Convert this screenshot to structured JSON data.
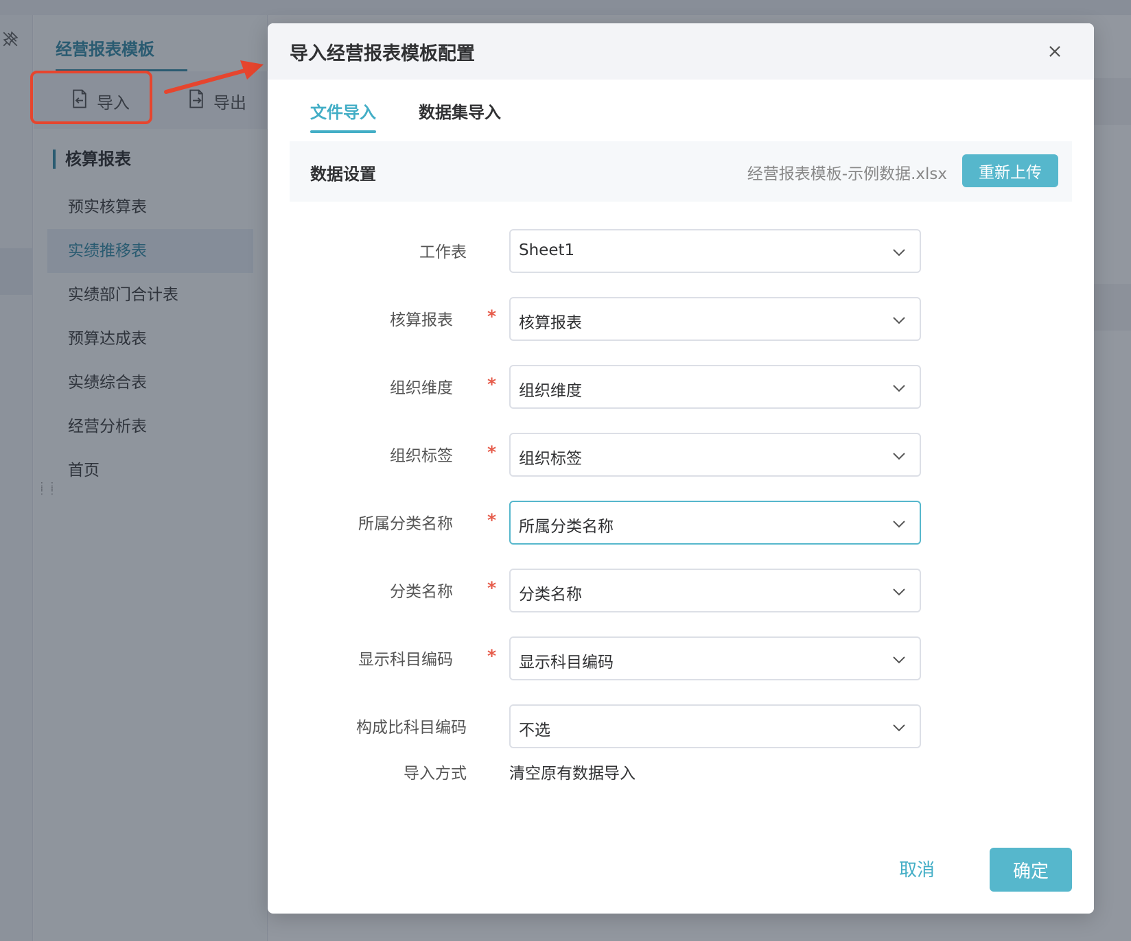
{
  "sidebar": {
    "title": "经营报表模板",
    "toolbar": {
      "import_label": "导入",
      "export_label": "导出"
    },
    "group_title": "核算报表",
    "items": [
      {
        "label": "预实核算表"
      },
      {
        "label": "实绩推移表",
        "active": true
      },
      {
        "label": "实绩部门合计表"
      },
      {
        "label": "预算达成表"
      },
      {
        "label": "实绩综合表"
      },
      {
        "label": "经营分析表"
      },
      {
        "label": "首页"
      }
    ]
  },
  "dialog": {
    "title": "导入经营报表模板配置",
    "tabs": [
      {
        "label": "文件导入",
        "active": true
      },
      {
        "label": "数据集导入",
        "active": false
      }
    ],
    "section": {
      "title": "数据设置",
      "file_name": "经营报表模板-示例数据.xlsx",
      "reupload_label": "重新上传"
    },
    "fields": [
      {
        "label": "工作表",
        "required": false,
        "value": "Sheet1"
      },
      {
        "label": "核算报表",
        "required": true,
        "value": "核算报表"
      },
      {
        "label": "组织维度",
        "required": true,
        "value": "组织维度"
      },
      {
        "label": "组织标签",
        "required": true,
        "value": "组织标签"
      },
      {
        "label": "所属分类名称",
        "required": true,
        "value": "所属分类名称",
        "focused": true
      },
      {
        "label": "分类名称",
        "required": true,
        "value": "分类名称"
      },
      {
        "label": "显示科目编码",
        "required": true,
        "value": "显示科目编码"
      },
      {
        "label": "构成比科目编码",
        "required": false,
        "value": "不选"
      }
    ],
    "import_mode": {
      "label": "导入方式",
      "value": "清空原有数据导入"
    },
    "required_mark": "*",
    "footer": {
      "cancel_label": "取消",
      "ok_label": "确定"
    }
  },
  "colors": {
    "accent": "#43aec6",
    "button": "#56b7cc",
    "required": "#e65b4a",
    "annotation": "#e6452e"
  }
}
